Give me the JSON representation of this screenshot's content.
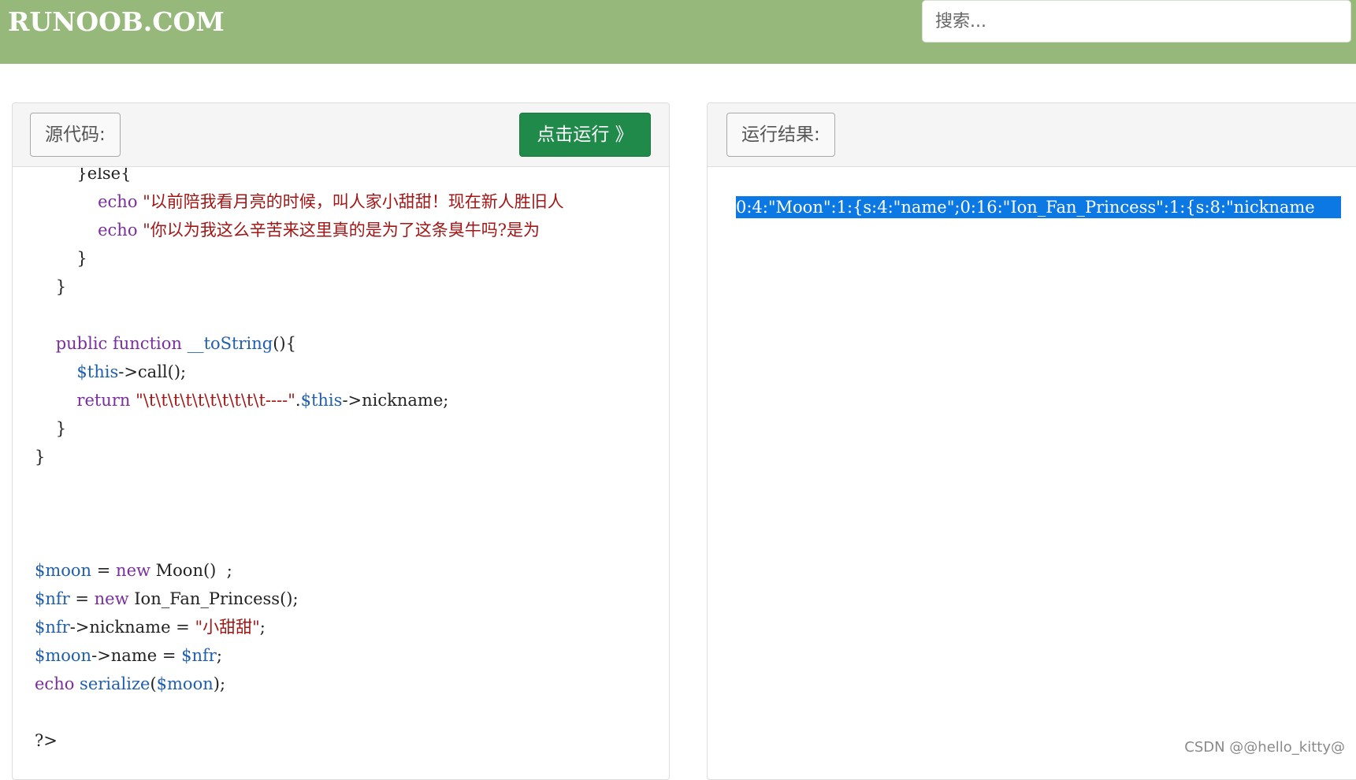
{
  "header": {
    "logo": "RUNOOB.COM",
    "search_placeholder": "搜索..."
  },
  "source_panel": {
    "label": "源代码:",
    "run_button": "点击运行 》",
    "lines": [
      [
        [
          "plain",
          "        }else{"
        ]
      ],
      [
        [
          "kw",
          "            echo "
        ],
        [
          "str",
          "\"以前陪我看月亮的时候，叫人家小甜甜！现在新人胜旧人"
        ]
      ],
      [
        [
          "kw",
          "            echo "
        ],
        [
          "str",
          "\"你以为我这么辛苦来这里真的是为了这条臭牛吗?是为"
        ]
      ],
      [
        [
          "plain",
          "        }"
        ]
      ],
      [
        [
          "plain",
          "    }"
        ]
      ],
      [
        [
          "plain",
          ""
        ]
      ],
      [
        [
          "kw",
          "    public function "
        ],
        [
          "fn",
          "__toString"
        ],
        [
          "plain",
          "(){"
        ]
      ],
      [
        [
          "var",
          "        $this"
        ],
        [
          "plain",
          "->call();"
        ]
      ],
      [
        [
          "kw",
          "        return "
        ],
        [
          "str",
          "\"\\t\\t\\t\\t\\t\\t\\t\\t\\t\\t----\""
        ],
        [
          "plain",
          "."
        ],
        [
          "var",
          "$this"
        ],
        [
          "plain",
          "->nickname;"
        ]
      ],
      [
        [
          "plain",
          "    }"
        ]
      ],
      [
        [
          "plain",
          "}"
        ]
      ],
      [
        [
          "plain",
          ""
        ]
      ],
      [
        [
          "plain",
          ""
        ]
      ],
      [
        [
          "plain",
          ""
        ]
      ],
      [
        [
          "var",
          "$moon"
        ],
        [
          "plain",
          " = "
        ],
        [
          "kw",
          "new "
        ],
        [
          "plain",
          "Moon()  ;"
        ]
      ],
      [
        [
          "var",
          "$nfr"
        ],
        [
          "plain",
          " = "
        ],
        [
          "kw",
          "new "
        ],
        [
          "plain",
          "Ion_Fan_Princess();"
        ]
      ],
      [
        [
          "var",
          "$nfr"
        ],
        [
          "plain",
          "->nickname = "
        ],
        [
          "str",
          "\"小甜甜\""
        ],
        [
          "plain",
          ";"
        ]
      ],
      [
        [
          "var",
          "$moon"
        ],
        [
          "plain",
          "->name = "
        ],
        [
          "var",
          "$nfr"
        ],
        [
          "plain",
          ";"
        ]
      ],
      [
        [
          "kw",
          "echo "
        ],
        [
          "fn",
          "serialize"
        ],
        [
          "plain",
          "("
        ],
        [
          "var",
          "$moon"
        ],
        [
          "plain",
          ");"
        ]
      ],
      [
        [
          "plain",
          ""
        ]
      ],
      [
        [
          "plain",
          "?>"
        ]
      ]
    ]
  },
  "result_panel": {
    "label": "运行结果:",
    "output": "0:4:\"Moon\":1:{s:4:\"name\";0:16:\"Ion_Fan_Princess\":1:{s:8:\"nickname"
  },
  "watermark": "CSDN @@hello_kitty@"
}
